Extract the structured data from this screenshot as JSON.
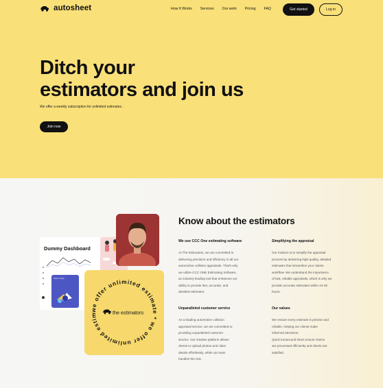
{
  "nav": {
    "logo": "autosheet",
    "links": [
      "How It Works",
      "Services",
      "Our work",
      "Pricing",
      "FAQ"
    ],
    "get_started": "Get started",
    "log_in": "Log in"
  },
  "hero": {
    "title_line1": "Ditch your",
    "title_line2": "estimators and join us",
    "subtitle": "We offer a weekly subscription for unlimited estimates .",
    "join_button": "Join now"
  },
  "visuals": {
    "dashboard_title": "Dummy Dashboard",
    "card_label": "Select Style",
    "badge_center": "the estimators",
    "badge_ring": "we offer unlimited estimate * we offer unlimited estimate *"
  },
  "about": {
    "title": "Know about the estimators",
    "sections": [
      {
        "heading": "We use CCC One estimating software",
        "lines": [
          "At The Estimators, we are committed to",
          "delivering precision and efficiency in all our",
          "automotive collision appraisals. That's why",
          "we utilize CCC ONE Estimating Software,",
          "an industry-leading tool that enhances our",
          "ability to provide fast, accurate, and",
          "detailed estimates."
        ]
      },
      {
        "heading": "Simplifying the appraisal",
        "lines": [
          "Our mission is to simplify the appraisal",
          "process by delivering high-quality, detailed",
          "estimates that streamline your claims",
          "workflow. We understand the importance",
          "of fast, reliable appraisals, which is why we",
          "provide accurate estimates within 24-48",
          "hours."
        ]
      },
      {
        "heading": "Unparalleled customer service",
        "lines": [
          "As a leading automotive collision",
          "appraisal service, we are committed to",
          "providing unparalleled customer",
          "service. Our intuitive platform allows",
          "clients to upload photos and claim",
          "details effortlessly, while our team",
          "handles the rest."
        ]
      },
      {
        "heading": "Our values",
        "lines": [
          "We ensure every estimate is precise and",
          "reliable, helping our clients make",
          "informed decisions.",
          "Quick turnaround times ensure claims",
          "are processed efficiently and clients are",
          "satisfied."
        ]
      }
    ]
  },
  "colors": {
    "hero_bg": "#f9e079",
    "badge_bg": "#f6d86d",
    "dark": "#111111"
  }
}
